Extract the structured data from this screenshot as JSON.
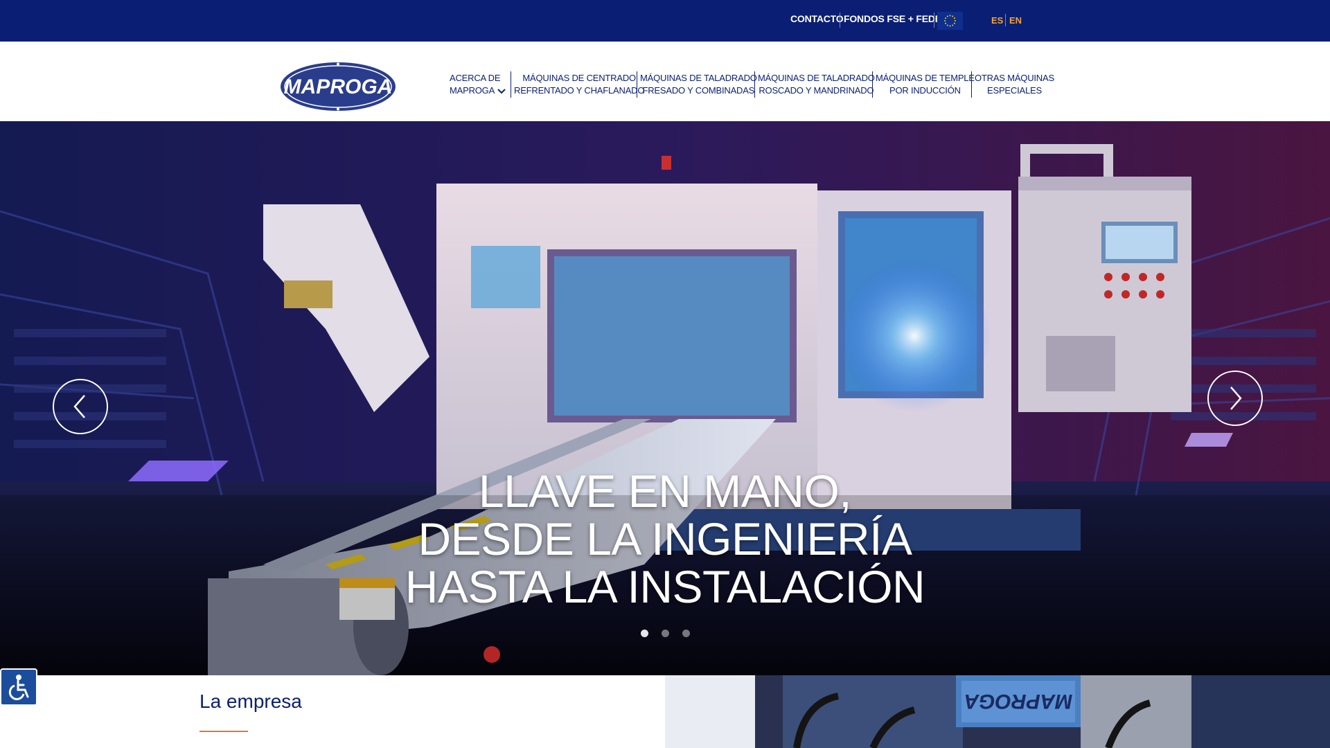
{
  "topbar": {
    "contact_label": "CONTACTO",
    "funds_label": "FONDOS FSE + FEDER",
    "flag_icon": "eu-flag-icon",
    "lang_es": "ES",
    "lang_en": "EN",
    "background_color": "#0a1f73",
    "lang_color": "#f2a23a"
  },
  "header": {
    "logo_text": "MAPROGA",
    "nav": [
      {
        "line1": "ACERCA DE",
        "line2": "MAPROGA"
      },
      {
        "line1": "MÁQUINAS DE CENTRADO",
        "line2": "REFRENTADO Y CHAFLANADO"
      },
      {
        "line1": "MÁQUINAS DE TALADRADO",
        "line2": "FRESADO Y COMBINADAS"
      },
      {
        "line1": "MÁQUINAS DE TALADRADO",
        "line2": "ROSCADO Y MANDRINADO"
      },
      {
        "line1": "MÁQUINAS DE TEMPLE",
        "line2": "POR INDUCCIÓN"
      },
      {
        "line1": "OTRAS MÁQUINAS",
        "line2": "ESPECIALES"
      }
    ],
    "nav_color": "#0a1f73"
  },
  "hero": {
    "title_lines": [
      "LLAVE EN MANO,",
      "DESDE LA INGENIERÍA",
      "HASTA LA INSTALACIÓN"
    ],
    "prev_icon": "chevron-left-icon",
    "next_icon": "chevron-right-icon",
    "slide_count": 3,
    "active_slide": 1
  },
  "about": {
    "title": "La empresa",
    "accent_color": "#e07a2a"
  },
  "accessibility": {
    "icon": "wheelchair-icon"
  }
}
